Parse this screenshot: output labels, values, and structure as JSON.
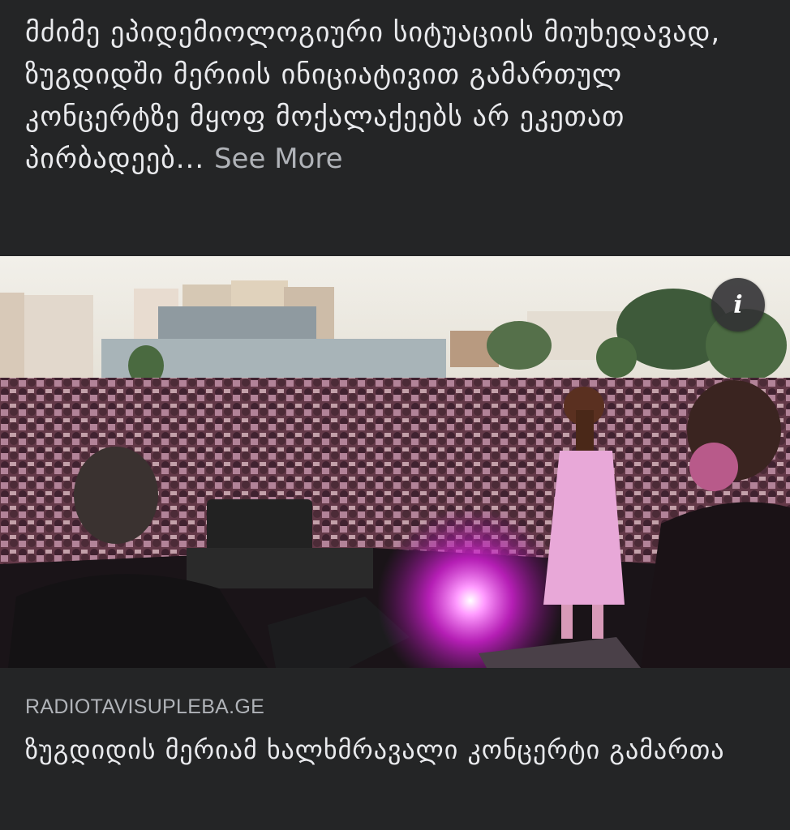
{
  "post": {
    "text": "მძიმე ეპიდემიოლოგიური სიტუაციის მიუხედავად, ზუგდიდში მერიის ინიციატივით გამართულ კონცერტზე მყოფ მოქალაქეებს არ ეკეთათ პირბადეებ...",
    "see_more": "See More"
  },
  "image": {
    "info_icon": "info-icon",
    "info_glyph": "i"
  },
  "link_preview": {
    "domain": "RADIOTAVISUPLEBA.GE",
    "title": "ზუგდიდის მერიამ ხალხმრავალი კონცერტი გამართა"
  },
  "colors": {
    "background": "#242526",
    "text": "#e9eaed",
    "secondary_text": "#b0b3b8",
    "stage_light": "#e040e0"
  }
}
